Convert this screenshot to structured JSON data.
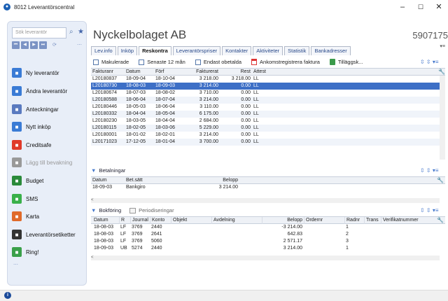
{
  "window": {
    "title": "8012 Leverantörscentral",
    "min": "–",
    "max": "☐",
    "close": "✕"
  },
  "sidebar": {
    "search_placeholder": "Sök leverantör",
    "items": [
      {
        "label": "Ny leverantör",
        "icon": "new-document-icon",
        "color": "#3a7bd5"
      },
      {
        "label": "Ändra leverantör",
        "icon": "edit-document-icon",
        "color": "#3a7bd5"
      },
      {
        "label": "Anteckningar",
        "icon": "notes-icon",
        "color": "#5a7abf"
      },
      {
        "label": "Nytt inköp",
        "icon": "new-purchase-icon",
        "color": "#3a7bd5"
      },
      {
        "label": "Creditsafe",
        "icon": "creditsafe-icon",
        "color": "#e03a2a"
      },
      {
        "label": "Lägg till bevakning",
        "icon": "watch-icon",
        "color": "#999999"
      },
      {
        "label": "Budget",
        "icon": "wallet-icon",
        "color": "#2a8a3a"
      },
      {
        "label": "SMS",
        "icon": "sms-icon",
        "color": "#3ab04a"
      },
      {
        "label": "Karta",
        "icon": "map-pin-icon",
        "color": "#e06a2a"
      },
      {
        "label": "Leverantörsetiketter",
        "icon": "label-icon",
        "color": "#333333"
      },
      {
        "label": "Ring!",
        "icon": "phone-icon",
        "color": "#3aa04a"
      }
    ]
  },
  "header": {
    "company": "Nyckelbolaget AB",
    "number": "5907175"
  },
  "tabs": [
    "Lev.info",
    "Inköp",
    "Reskontra",
    "Leverantörspriser",
    "Kontakter",
    "Aktiviteter",
    "Statistik",
    "Bankadresser"
  ],
  "active_tab": "Reskontra",
  "toolbar": {
    "makulerade": "Makulerade",
    "senaste": "Senaste 12 mån",
    "obetalda": "Endast obetalda",
    "ankomst": "Ankomstregistrera faktura",
    "tillagg": "Tilläggsk..."
  },
  "invoices": {
    "headers": [
      "Fakturanr",
      "Datum",
      "Förf",
      "Fakturerat",
      "Rest",
      "Attest"
    ],
    "rows": [
      [
        "L20180837",
        "18-09-04",
        "18-10-04",
        "3 218.00",
        "3 218.00",
        "LL"
      ],
      [
        "L20180730",
        "18-08-03",
        "18-09-03",
        "3 214.00",
        "0.00",
        "LL"
      ],
      [
        "L20180674",
        "18-07-03",
        "18-08-02",
        "3 710.00",
        "0.00",
        "LL"
      ],
      [
        "L20180588",
        "18-06-04",
        "18-07-04",
        "3 214.00",
        "0.00",
        "LL"
      ],
      [
        "L20180446",
        "18-05-03",
        "18-06-04",
        "3 110.00",
        "0.00",
        "LL"
      ],
      [
        "L20180332",
        "18-04-04",
        "18-05-04",
        "6 175.00",
        "0.00",
        "LL"
      ],
      [
        "L20180230",
        "18-03-05",
        "18-04-04",
        "2 684.00",
        "0.00",
        "LL"
      ],
      [
        "L20180115",
        "18-02-05",
        "18-03-06",
        "5 229.00",
        "0.00",
        "LL"
      ],
      [
        "L20180001",
        "18-01-02",
        "18-02-01",
        "3 214.00",
        "0.00",
        "LL"
      ],
      [
        "L20171023",
        "17-12-05",
        "18-01-04",
        "3 700.00",
        "0.00",
        "LL"
      ]
    ],
    "selected": 1
  },
  "payments": {
    "title": "Betalningar",
    "headers": [
      "Datum",
      "Bet.sätt",
      "Belopp"
    ],
    "rows": [
      [
        "18-09-03",
        "Bankgiro",
        "3 214.00"
      ]
    ]
  },
  "bookings": {
    "title": "Bokföring",
    "tab2": "Periodiseringar",
    "headers": [
      "Datum",
      "R",
      "Journal",
      "Konto",
      "Objekt",
      "Avdelning",
      "Belopp",
      "Ordernr",
      "Radnr",
      "Trans",
      "Verifikatnummer"
    ],
    "rows": [
      [
        "18-08-03",
        "LF",
        "3769",
        "2440",
        "",
        "",
        "-3 214.00",
        "",
        "1",
        "",
        ""
      ],
      [
        "18-08-03",
        "LF",
        "3769",
        "2641",
        "",
        "",
        "642.83",
        "",
        "2",
        "",
        ""
      ],
      [
        "18-08-03",
        "LF",
        "3769",
        "5060",
        "",
        "",
        "2 571.17",
        "",
        "3",
        "",
        ""
      ],
      [
        "18-09-03",
        "UB",
        "5274",
        "2440",
        "",
        "",
        "3 214.00",
        "",
        "1",
        "",
        ""
      ]
    ]
  }
}
